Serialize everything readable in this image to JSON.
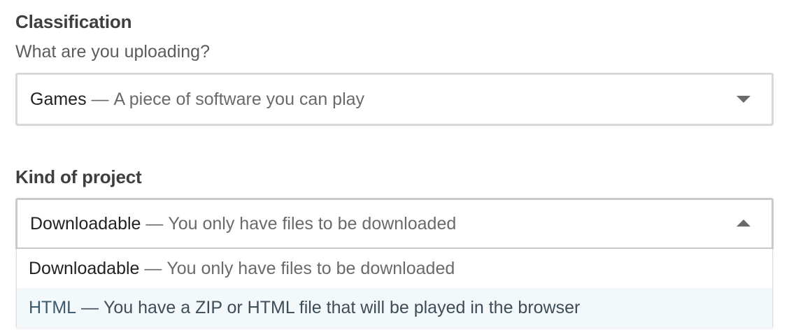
{
  "classification": {
    "heading": "Classification",
    "question": "What are you uploading?",
    "selected": {
      "name": "Games",
      "separator": " — ",
      "description": "A piece of software you can play"
    }
  },
  "kind_of_project": {
    "heading": "Kind of project",
    "selected": {
      "name": "Downloadable",
      "separator": " — ",
      "description": "You only have files to be downloaded"
    },
    "options": [
      {
        "name": "Downloadable",
        "separator": " — ",
        "description": "You only have files to be downloaded",
        "highlighted": false
      },
      {
        "name": "HTML",
        "separator": " — ",
        "description": "You have a ZIP or HTML file that will be played in the browser",
        "highlighted": true
      }
    ]
  },
  "icons": {
    "classification_caret": "chevron-down-icon",
    "kind_caret": "chevron-up-icon"
  }
}
